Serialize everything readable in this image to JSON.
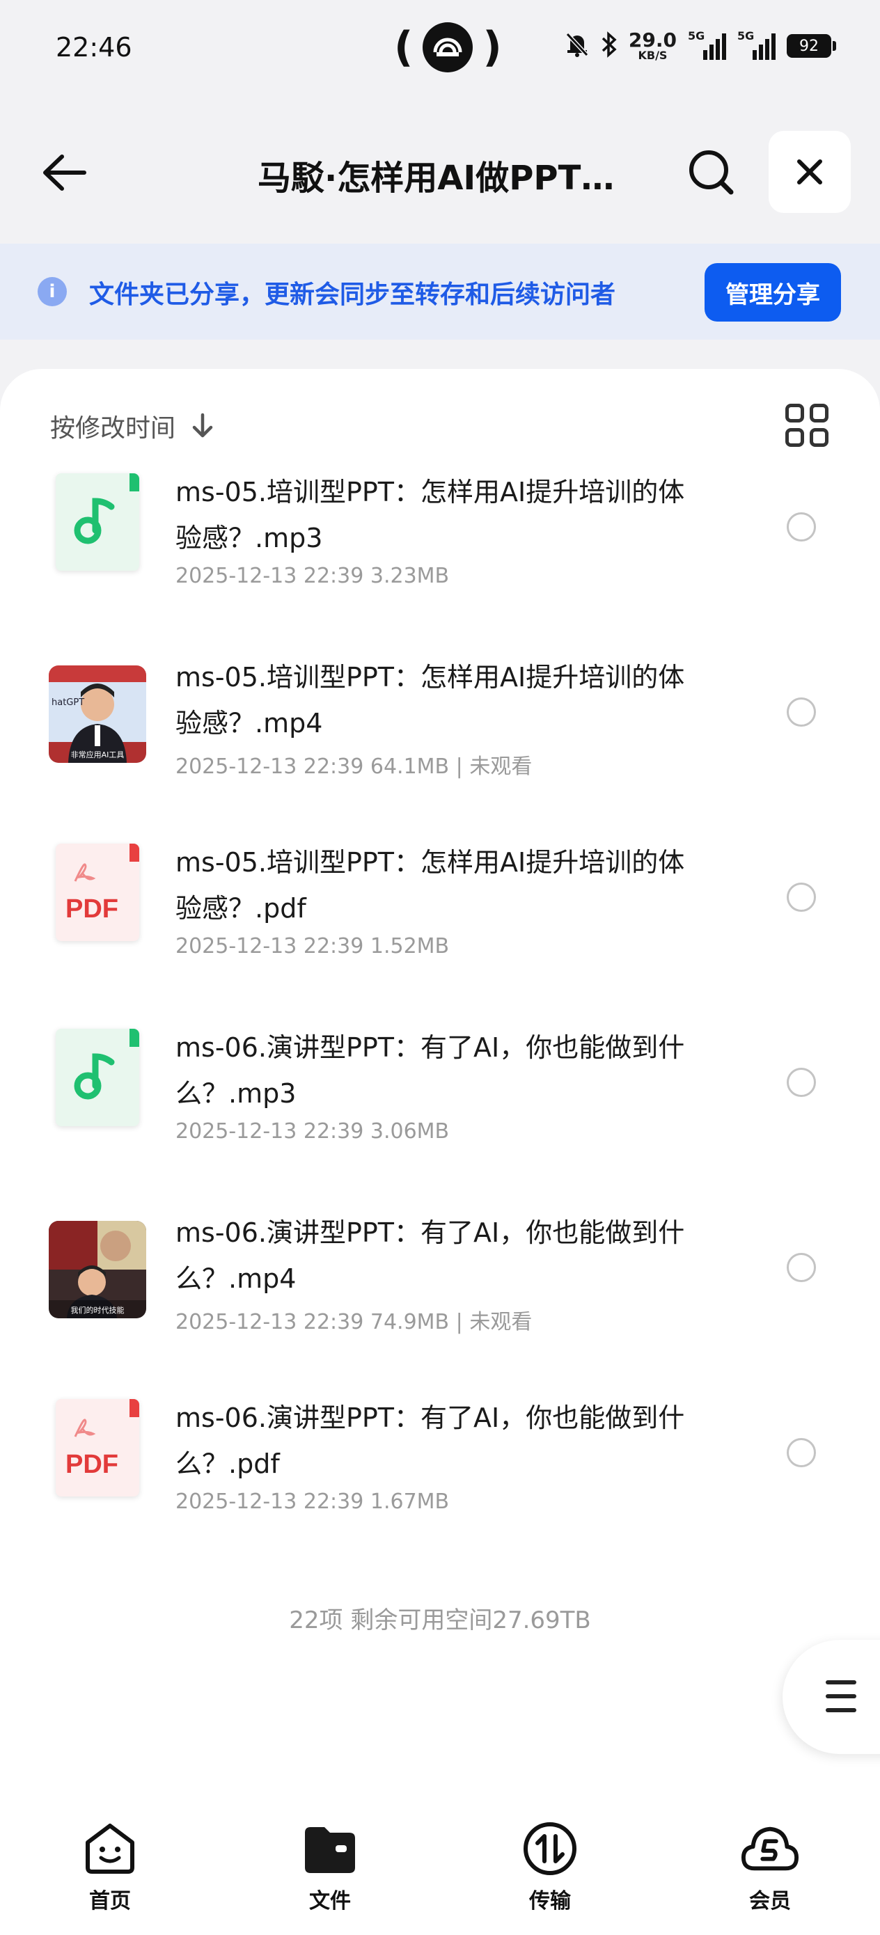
{
  "status_bar": {
    "time": "22:46",
    "speed_value": "29.0",
    "speed_unit": "KB/S",
    "sig1_label": "5G",
    "sig2_label": "5G",
    "battery": "92"
  },
  "header": {
    "title": "马駁·怎样用AI做PPT…"
  },
  "banner": {
    "text": "文件夹已分享，更新会同步至转存和后续访问者",
    "button_label": "管理分享"
  },
  "sort": {
    "label": "按修改时间"
  },
  "files": [
    {
      "type": "audio",
      "name": "ms-05.培训型PPT：怎样用AI提升培训的体验感？.mp3",
      "meta": "2025-12-13 22:39  3.23MB"
    },
    {
      "type": "video",
      "name": "ms-05.培训型PPT：怎样用AI提升培训的体验感？.mp4",
      "meta": "2025-12-13 22:39  64.1MB | 未观看"
    },
    {
      "type": "pdf",
      "name": "ms-05.培训型PPT：怎样用AI提升培训的体验感？.pdf",
      "meta": "2025-12-13 22:39  1.52MB"
    },
    {
      "type": "audio",
      "name": "ms-06.演讲型PPT：有了AI，你也能做到什么？.mp3",
      "meta": "2025-12-13 22:39  3.06MB"
    },
    {
      "type": "video",
      "name": "ms-06.演讲型PPT：有了AI，你也能做到什么？.mp4",
      "meta": "2025-12-13 22:39  74.9MB | 未观看"
    },
    {
      "type": "pdf",
      "name": "ms-06.演讲型PPT：有了AI，你也能做到什么？.pdf",
      "meta": "2025-12-13 22:39  1.67MB"
    }
  ],
  "thumb_text": {
    "pdf": "PDF",
    "video1_caption": "非常应用AI工具",
    "video1_tag": "hatGPT",
    "video2_caption": "我们的时代技能"
  },
  "footer": {
    "count_text": "22项 剩余可用空间27.69TB"
  },
  "bottom_nav": [
    {
      "label": "首页",
      "icon": "home-face-icon"
    },
    {
      "label": "文件",
      "icon": "folder-icon"
    },
    {
      "label": "传输",
      "icon": "transfer-icon"
    },
    {
      "label": "会员",
      "icon": "vip-cloud-icon"
    }
  ],
  "colors": {
    "accent": "#0d5cf0",
    "banner_bg": "#e7ecf8",
    "banner_text": "#1f5be6",
    "audio_green": "#1fc070",
    "pdf_red": "#e23a3a"
  }
}
